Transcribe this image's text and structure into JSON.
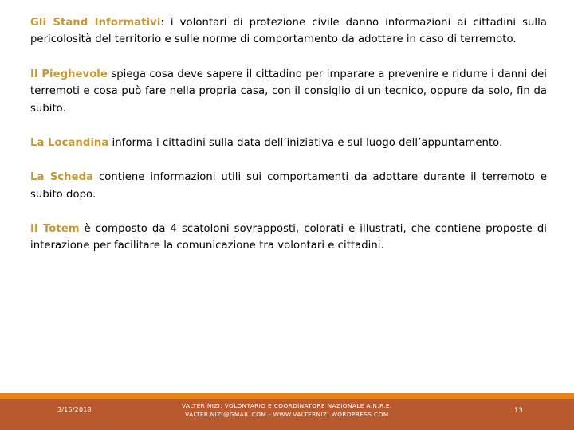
{
  "slide": {
    "accent_gold": "#C8972F",
    "accent_orange": "#E8841A",
    "accent_terracotta": "#B85A2E",
    "body_color": "#000000",
    "paragraphs": [
      {
        "lead": "Gli Stand Informativi",
        "rest": ": i volontari di protezione civile danno informazioni ai cittadini sulla pericolosità del territorio e sulle norme di comportamento da adottare in caso di terremoto."
      },
      {
        "lead": "Il Pieghevole",
        "rest": " spiega cosa deve sapere il cittadino per imparare a prevenire e ridurre i danni dei terremoti e cosa può fare nella propria casa, con il consiglio di un tecnico, oppure da solo, fin da subito."
      },
      {
        "lead": "La Locandina",
        "rest": " informa i cittadini sulla data dell’iniziativa e sul luogo dell’appuntamento."
      },
      {
        "lead": "La Scheda",
        "rest": " contiene informazioni utili sui comportamenti da adottare durante il terremoto e subito dopo."
      },
      {
        "lead": "Il Totem",
        "rest": " è composto da 4 scatoloni sovrapposti, colorati e illustrati, che contiene proposte di interazione per facilitare la comunicazione tra volontari e cittadini."
      }
    ]
  },
  "footer": {
    "date": "3/15/2018",
    "credit_line_1": "VALTER NIZI: VOLONTARIO E COORDINATORE NAZIONALE A.N.R.E.",
    "credit_line_2": "VALTER.NIZI@GMAIL.COM - WWW.VALTERNIZI.WORDPRESS.COM",
    "page_number": "13"
  }
}
